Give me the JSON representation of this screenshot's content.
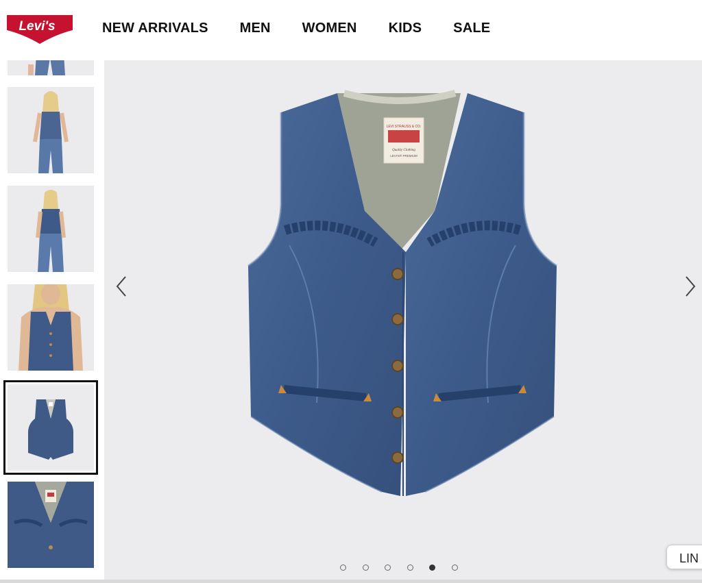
{
  "brand": {
    "logo_text": "Levi's",
    "registered_mark": "®",
    "color": "#c41230"
  },
  "nav": {
    "items": [
      {
        "label": "NEW ARRIVALS"
      },
      {
        "label": "MEN"
      },
      {
        "label": "WOMEN"
      },
      {
        "label": "KIDS"
      },
      {
        "label": "SALE"
      }
    ]
  },
  "gallery": {
    "thumbnails": [
      {
        "name": "partial-model-jeans"
      },
      {
        "name": "model-front-full"
      },
      {
        "name": "model-back-full"
      },
      {
        "name": "model-closeup"
      },
      {
        "name": "vest-flat",
        "selected": true
      },
      {
        "name": "vest-detail"
      }
    ],
    "total_slides": 6,
    "active_slide": 5,
    "prev_icon": "chevron-left-icon",
    "next_icon": "chevron-right-icon"
  },
  "product_label": {
    "line1": "LEVI STRAUSS & CO.",
    "line2": "Quality Clothing",
    "line3": "LEVI'S® PREMIUM"
  },
  "chat": {
    "label": "LIN"
  },
  "colors": {
    "denim": "#3f5a86",
    "viewer_bg": "#ececee",
    "stitch": "#c98a3c"
  }
}
